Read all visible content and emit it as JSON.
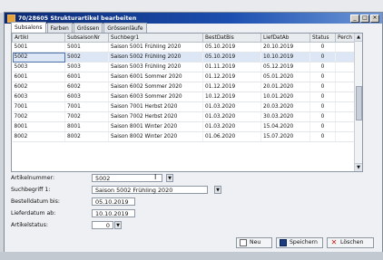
{
  "window": {
    "title": "70/28605 Strukturartikel bearbeiten",
    "controls": [
      "_",
      "□",
      "×"
    ]
  },
  "tabs": [
    {
      "label": "Subsalons",
      "active": true
    },
    {
      "label": "Farben",
      "active": false
    },
    {
      "label": "Grössen",
      "active": false
    },
    {
      "label": "Grössenläufe",
      "active": false
    }
  ],
  "grid": {
    "columns": [
      "Artikl",
      "SubsaisonNr",
      "Suchbegr1",
      "BestDatBis",
      "LiefDatAb",
      "Status",
      "Perch"
    ],
    "rows": [
      [
        "5001",
        "5001",
        "Saison 5001 Frühling 2020",
        "05.10.2019",
        "20.10.2019",
        "0",
        ""
      ],
      [
        "5002",
        "5002",
        "Saison 5002 Frühling 2020",
        "05.10.2019",
        "10.10.2019",
        "0",
        ""
      ],
      [
        "5003",
        "5003",
        "Saison 5003 Frühling 2020",
        "01.11.2019",
        "05.12.2019",
        "0",
        ""
      ],
      [
        "6001",
        "6001",
        "Saison 6001 Sommer 2020",
        "01.12.2019",
        "05.01.2020",
        "0",
        ""
      ],
      [
        "6002",
        "6002",
        "Saison 6002 Sommer 2020",
        "01.12.2019",
        "20.01.2020",
        "0",
        ""
      ],
      [
        "6003",
        "6003",
        "Saison 6003 Sommer 2020",
        "10.12.2019",
        "10.01.2020",
        "0",
        ""
      ],
      [
        "7001",
        "7001",
        "Saison 7001 Herbst 2020",
        "01.03.2020",
        "20.03.2020",
        "0",
        ""
      ],
      [
        "7002",
        "7002",
        "Saison 7002 Herbst 2020",
        "01.03.2020",
        "30.03.2020",
        "0",
        ""
      ],
      [
        "8001",
        "8001",
        "Saison 8001 Winter 2020",
        "01.03.2020",
        "15.04.2020",
        "0",
        ""
      ],
      [
        "8002",
        "8002",
        "Saison 8002 Winter 2020",
        "01.06.2020",
        "15.07.2020",
        "0",
        ""
      ]
    ],
    "selected_row": 1
  },
  "form": {
    "artikelnummer_label": "Artikelnummer:",
    "artikelnummer_value": "5002",
    "suchbegriff_label": "Suchbegriff 1:",
    "suchbegriff_value": "Saison 5002 Frühling 2020",
    "bestelldatum_label": "Bestelldatum bis:",
    "bestelldatum_value": "05.10.2019",
    "lieferdatum_label": "Lieferdatum ab:",
    "lieferdatum_value": "10.10.2019",
    "status_label": "Artikelstatus:",
    "status_value": "0"
  },
  "buttons": {
    "new_label": "Neu",
    "save_label": "Speichern",
    "delete_label": "Löschen"
  }
}
